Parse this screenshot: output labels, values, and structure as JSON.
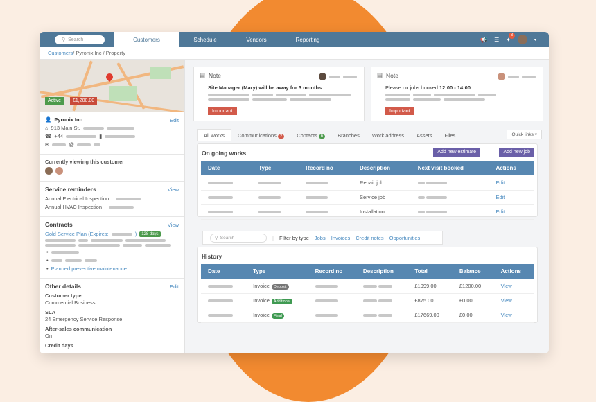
{
  "nav": {
    "search_placeholder": "Search",
    "tabs": [
      "Customers",
      "Schedule",
      "Vendors",
      "Reporting"
    ],
    "notification_count": "3"
  },
  "breadcrumb": {
    "root": "Customers",
    "rest": " / Pyronix Inc / Property"
  },
  "customer": {
    "status": "Active",
    "amount": "£1,200.00",
    "name": "Pyronix Inc",
    "address": "913 Main St,",
    "phone_prefix": "+44",
    "email_at": "@",
    "edit": "Edit"
  },
  "viewing": {
    "title": "Currently viewing this customer"
  },
  "service_reminders": {
    "title": "Service reminders",
    "view": "View",
    "items": [
      "Annual Electrical Inspection",
      "Annual HVAC Inspection"
    ]
  },
  "contracts": {
    "title": "Contracts",
    "view": "View",
    "plan": "Gold Service Plan (Expires:",
    "plan_close": ")",
    "days": "128 days",
    "maintenance": "Planned preventive maintenance"
  },
  "other_details": {
    "title": "Other details",
    "edit": "Edit",
    "customer_type_label": "Customer type",
    "customer_type": "Commercial Business",
    "sla_label": "SLA",
    "sla": "24 Emergency Service Response",
    "aftersales_label": "After-sales communication",
    "aftersales": "On",
    "credit_label": "Credit days"
  },
  "notes": [
    {
      "title": "Note",
      "text": "Site Manager (Mary) will be away for 3 months",
      "button": "Important"
    },
    {
      "title": "Note",
      "text_prefix": "Please no jobs booked ",
      "text_bold": "12:00 - 14:00",
      "button": "Important"
    }
  ],
  "content_tabs": {
    "all_works": "All works",
    "communications": "Communications",
    "communications_count": "2",
    "contacts": "Contacts",
    "contacts_count": "6",
    "branches": "Branches",
    "work_address": "Work address",
    "assets": "Assets",
    "files": "Files",
    "quick_links": "Quick links"
  },
  "ongoing": {
    "title": "On going works",
    "add_estimate": "Add new estimate",
    "add_job": "Add new job",
    "headers": [
      "Date",
      "Type",
      "Record no",
      "Description",
      "Next visit booked",
      "Actions"
    ],
    "rows": [
      {
        "description": "Repair job",
        "action": "Edit"
      },
      {
        "description": "Service job",
        "action": "Edit"
      },
      {
        "description": "Installation",
        "action": "Edit"
      }
    ]
  },
  "filter": {
    "search_placeholder": "Search",
    "label": "Filter by type",
    "options": [
      "Jobs",
      "Invoices",
      "Credit notes",
      "Opportunities"
    ]
  },
  "history": {
    "title": "History",
    "headers": [
      "Date",
      "Type",
      "Record no",
      "Description",
      "Total",
      "Balance",
      "Actions"
    ],
    "rows": [
      {
        "type": "Invoice",
        "pill": "Deposit",
        "pill_color": "#777777",
        "total": "£1999.00",
        "balance": "£1200.00",
        "action": "View"
      },
      {
        "type": "Invoice",
        "pill": "Additional",
        "pill_color": "#3f9a52",
        "total": "£875.00",
        "balance": "£0.00",
        "action": "View"
      },
      {
        "type": "Invoice",
        "pill": "Final",
        "pill_color": "#3f9a52",
        "total": "£17669.00",
        "balance": "£0.00",
        "action": "View"
      }
    ]
  },
  "colors": {
    "nav": "#4f7898",
    "table_header": "#5787b1",
    "important": "#d25a4a",
    "purple_button": "#6a5fa8",
    "accent": "#f28a30"
  }
}
